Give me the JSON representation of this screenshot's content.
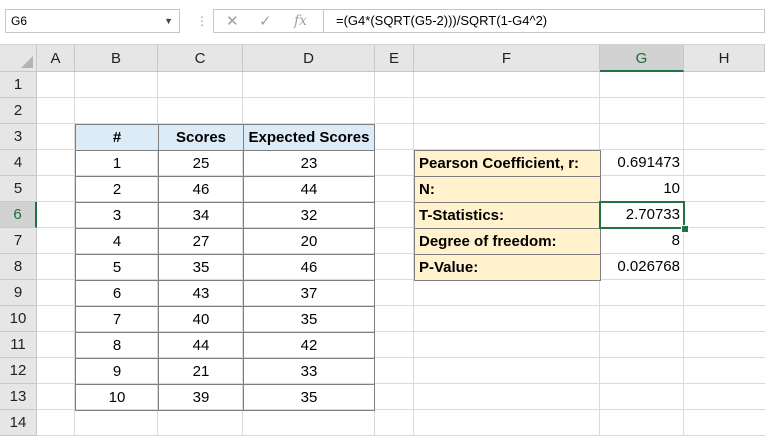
{
  "formula_bar": {
    "name_box": "G6",
    "cancel_icon": "✕",
    "enter_icon": "✓",
    "fx_label": "fx",
    "formula": "=(G4*(SQRT(G5-2)))/SQRT(1-G4^2)"
  },
  "columns": [
    "A",
    "B",
    "C",
    "D",
    "E",
    "F",
    "G",
    "H"
  ],
  "rows": [
    "1",
    "2",
    "3",
    "4",
    "5",
    "6",
    "7",
    "8",
    "9",
    "10",
    "11",
    "12",
    "13",
    "14"
  ],
  "selected": {
    "column": "G",
    "row": "6"
  },
  "table": {
    "headers": [
      "#",
      "Scores",
      "Expected Scores"
    ],
    "rows": [
      [
        "1",
        "25",
        "23"
      ],
      [
        "2",
        "46",
        "44"
      ],
      [
        "3",
        "34",
        "32"
      ],
      [
        "4",
        "27",
        "20"
      ],
      [
        "5",
        "35",
        "46"
      ],
      [
        "6",
        "43",
        "37"
      ],
      [
        "7",
        "40",
        "35"
      ],
      [
        "8",
        "44",
        "42"
      ],
      [
        "9",
        "21",
        "33"
      ],
      [
        "10",
        "39",
        "35"
      ]
    ]
  },
  "stats": [
    {
      "label": "Pearson Coefficient, r:",
      "value": "0.691473"
    },
    {
      "label": "N:",
      "value": "10"
    },
    {
      "label": "T-Statistics:",
      "value": "2.70733"
    },
    {
      "label": "Degree of freedom:",
      "value": "8"
    },
    {
      "label": "P-Value:",
      "value": "0.026768"
    }
  ],
  "colors": {
    "accent": "#217346",
    "header_fill": "#ddebf7",
    "stats_fill": "#fff2cc"
  }
}
